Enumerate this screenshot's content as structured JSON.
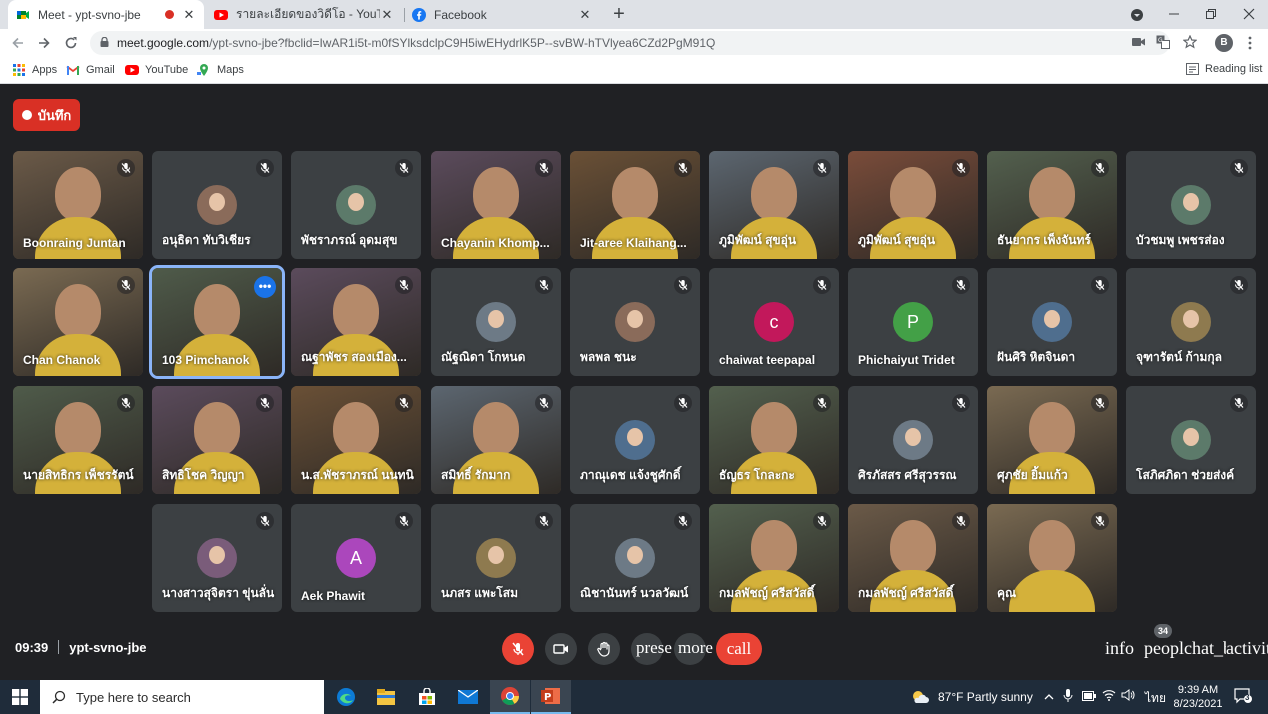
{
  "browser": {
    "tabs": [
      {
        "title": "Meet - ypt-svno-jbe",
        "active": true,
        "favicon": "google-meet-icon",
        "recording": true
      },
      {
        "title": "รายละเอียดของวิดีโอ - YouTube Studio",
        "active": false,
        "favicon": "youtube-icon"
      },
      {
        "title": "Facebook",
        "active": false,
        "favicon": "facebook-icon"
      }
    ],
    "new_tab_glyph": "+",
    "url_host": "meet.google.com",
    "url_rest": "/ypt-svno-jbe?fbclid=IwAR1i5t-m0fSYlksdclpC9H5iwEHydrlK5P--svBW-hTVlyea6CZd2PgM91Q",
    "profile_initial": "B",
    "bookmarks": [
      "Apps",
      "Gmail",
      "YouTube",
      "Maps"
    ],
    "reading_list": "Reading list"
  },
  "meet": {
    "record_label": "บันทึก",
    "meeting_time": "09:39",
    "meeting_code": "ypt-svno-jbe",
    "participant_count": "34",
    "controls": {
      "present": "prese",
      "more": "more",
      "call": "call"
    },
    "right_controls": {
      "info": "info",
      "people": "people",
      "chat": "chat_bubble",
      "activities": "activities"
    },
    "colors": {
      "accent": "#1a73e8",
      "danger": "#ea4335",
      "tile": "#3c4043",
      "background": "#202124"
    },
    "participants": [
      {
        "name": "Boonraing Juntan",
        "type": "video"
      },
      {
        "name": "อนุธิดา ทับวิเชียร",
        "type": "avatar"
      },
      {
        "name": "พัชราภรณ์ อุดมสุข",
        "type": "avatar"
      },
      {
        "name": "Chayanin Khomp...",
        "type": "video"
      },
      {
        "name": "Jit-aree Klaihang...",
        "type": "video"
      },
      {
        "name": "ภูมิพัฒน์ สุขอุ่น",
        "type": "video"
      },
      {
        "name": "ภูมิพัฒน์ สุขอุ่น",
        "type": "video"
      },
      {
        "name": "ธันยากร เพ็งจันทร์",
        "type": "video"
      },
      {
        "name": "บัวชมพู เพชรส่อง",
        "type": "avatar"
      },
      {
        "name": "Chan Chanok",
        "type": "video"
      },
      {
        "name": "103 Pimchanok",
        "type": "video",
        "speaking": true
      },
      {
        "name": "ณฐาพัชร สองเมือง...",
        "type": "video"
      },
      {
        "name": "ณัฐณิดา โกหนด",
        "type": "avatar"
      },
      {
        "name": "พลพล ชนะ",
        "type": "avatar"
      },
      {
        "name": "chaiwat teepapal",
        "type": "letter",
        "letter": "c",
        "color": "#c2185b"
      },
      {
        "name": "Phichaiyut Tridet",
        "type": "letter",
        "letter": "P",
        "color": "#43a047"
      },
      {
        "name": "ฝันศิริ หิตจินดา",
        "type": "avatar"
      },
      {
        "name": "จุฑารัตน์ ก้ามกุล",
        "type": "avatar"
      },
      {
        "name": "นายสิทธิกร เพ็ชรรัตน์",
        "type": "video"
      },
      {
        "name": "สิทธิโชค วิญญา",
        "type": "video"
      },
      {
        "name": "น.ส.พัชราภรณ์ นนทนิ",
        "type": "video"
      },
      {
        "name": "สมิทธิ์ รักมาก",
        "type": "video"
      },
      {
        "name": "ภาณุเดช แจ้งชูศักดิ์",
        "type": "avatar"
      },
      {
        "name": "ธัญธร โกละกะ",
        "type": "video"
      },
      {
        "name": "ศิรภัสสร ศรีสุวรรณ",
        "type": "avatar"
      },
      {
        "name": "ศุภชัย ยิ้มแก้ว",
        "type": "video"
      },
      {
        "name": "โสภิศภิดา ช่วยส่งค์",
        "type": "avatar"
      },
      {
        "name": "นางสาวสุจิตรา ขุ่นลั่น",
        "type": "avatar"
      },
      {
        "name": "Aek Phawit",
        "type": "letter",
        "letter": "A",
        "color": "#ab47bc"
      },
      {
        "name": "นภสร แพะโสม",
        "type": "avatar"
      },
      {
        "name": "ณิชานันทร์ นวลวัฒน์",
        "type": "avatar"
      },
      {
        "name": "กมลพัชญ์ ศรีสวัสดิ์",
        "type": "video"
      },
      {
        "name": "กมลพัชญ์ ศรีสวัสดิ์",
        "type": "video"
      },
      {
        "name": "คุณ",
        "type": "video"
      }
    ]
  },
  "taskbar": {
    "search_placeholder": "Type here to search",
    "weather": "87°F  Partly sunny",
    "lang": "ไทย",
    "time": "9:39 AM",
    "date": "8/23/2021",
    "notifications": "3"
  }
}
